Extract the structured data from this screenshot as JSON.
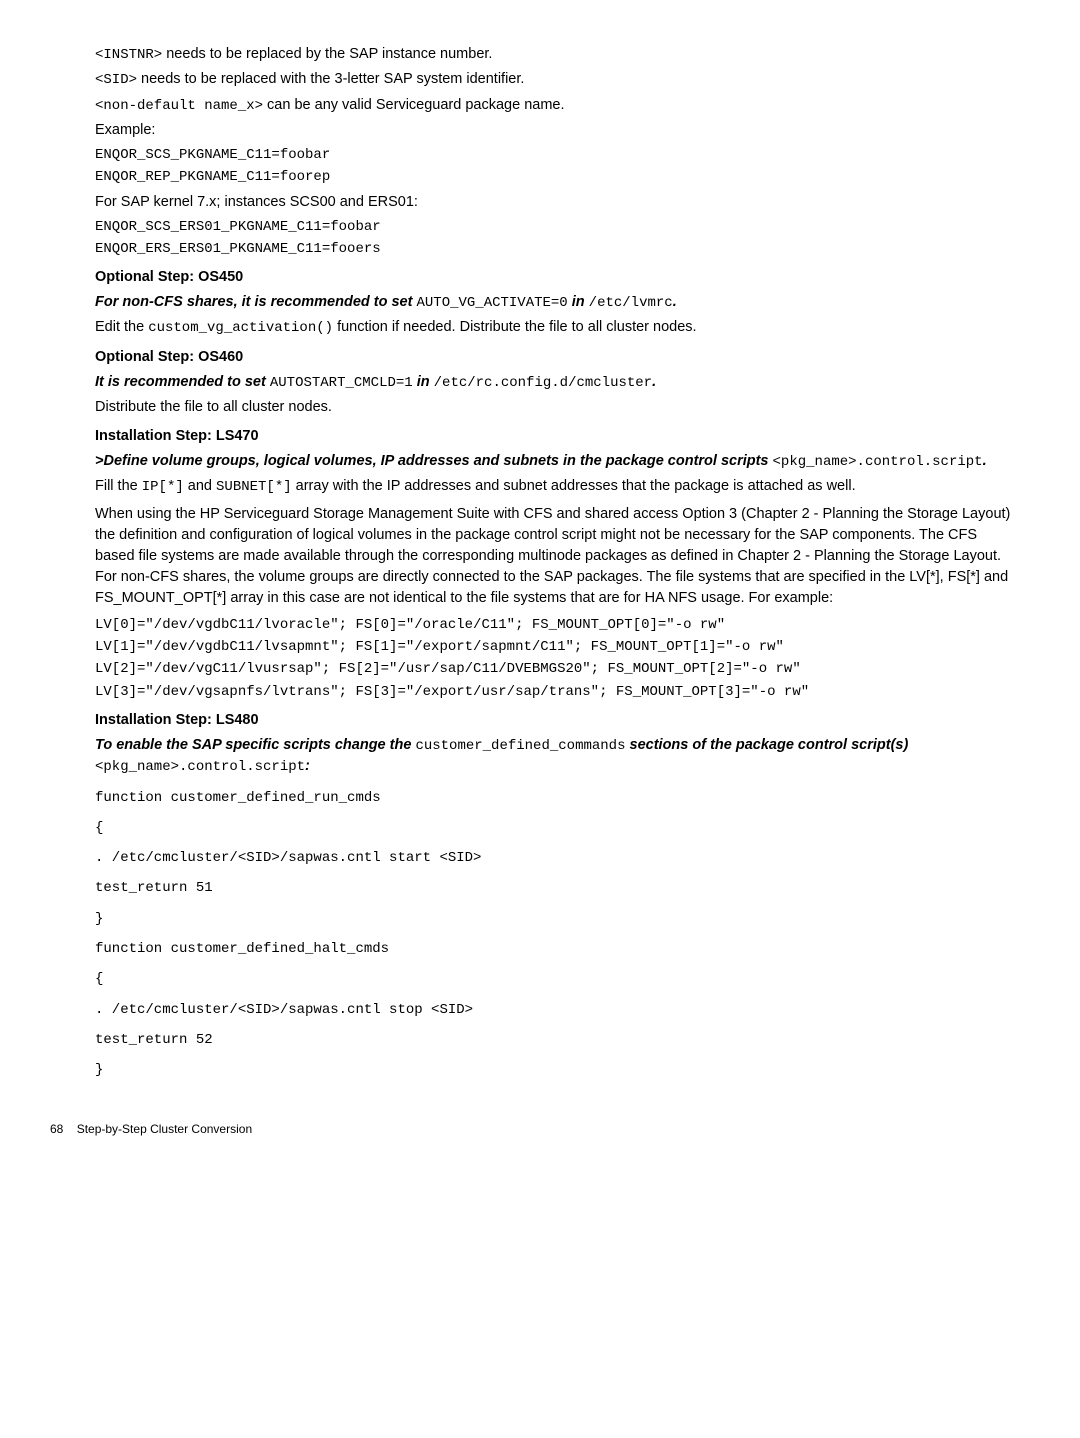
{
  "p1a": "<INSTNR>",
  "p1b": " needs to be replaced by the SAP instance number.",
  "p2a": "<SID>",
  "p2b": " needs to be replaced with the 3-letter SAP system identifier.",
  "p3a": "<non-default name_x>",
  "p3b": " can be any valid Serviceguard package name.",
  "p4": "Example:",
  "p5": "ENQOR_SCS_PKGNAME_C11=foobar",
  "p6": "ENQOR_REP_PKGNAME_C11=foorep",
  "p7": "For SAP kernel 7.x; instances SCS00 and ERS01:",
  "p8": "ENQOR_SCS_ERS01_PKGNAME_C11=foobar",
  "p9": "ENQOR_ERS_ERS01_PKGNAME_C11=fooers",
  "h1": "Optional Step: OS450",
  "p10a": "For non-CFS shares, it is recommended to set ",
  "p10b": "AUTO_VG_ACTIVATE=0",
  "p10c": " in ",
  "p10d": "/etc/lvmrc",
  "p10e": ".",
  "p11a": "Edit the ",
  "p11b": "custom_vg_activation()",
  "p11c": " function if needed. Distribute the file to all cluster nodes.",
  "h2": "Optional Step: OS460",
  "p12a": "It is recommended to set ",
  "p12b": "AUTOSTART_CMCLD=1",
  "p12c": " in ",
  "p12d": "/etc/rc.config.d/cmcluster",
  "p12e": ".",
  "p13": "Distribute the file to all cluster nodes.",
  "h3": "Installation Step: LS470",
  "p14a": ">Define volume groups, logical volumes, IP addresses and subnets in the package control scripts ",
  "p14b": "<pkg_name>.control.script",
  "p14c": ".",
  "p15a": "Fill the ",
  "p15b": "IP[*]",
  "p15c": " and ",
  "p15d": "SUBNET[*]",
  "p15e": " array with the IP addresses and subnet addresses that the package is attached as well.",
  "p16": "When using the HP Serviceguard Storage Management Suite with CFS and shared access Option 3 (Chapter 2 - Planning the Storage Layout) the definition and configuration of logical volumes in the package control script might not be necessary for the SAP components. The CFS based file systems are made available through the corresponding multinode packages as defined in Chapter 2 - Planning the Storage Layout. For non-CFS shares, the volume groups are directly connected to the SAP packages. The file systems that are specified in the LV[*], FS[*] and FS_MOUNT_OPT[*] array in this case are not identical to the file systems that are for HA NFS usage. For example:",
  "p17": "LV[0]=\"/dev/vgdbC11/lvoracle\"; FS[0]=\"/oracle/C11\"; FS_MOUNT_OPT[0]=\"-o rw\"",
  "p18": "LV[1]=\"/dev/vgdbC11/lvsapmnt\"; FS[1]=\"/export/sapmnt/C11\"; FS_MOUNT_OPT[1]=\"-o rw\"",
  "p19": "LV[2]=\"/dev/vgC11/lvusrsap\"; FS[2]=\"/usr/sap/C11/DVEBMGS20\"; FS_MOUNT_OPT[2]=\"-o rw\"",
  "p20": "LV[3]=\"/dev/vgsapnfs/lvtrans\"; FS[3]=\"/export/usr/sap/trans\"; FS_MOUNT_OPT[3]=\"-o rw\"",
  "h4": "Installation Step: LS480",
  "p21a": "To enable the SAP specific scripts change the ",
  "p21b": "customer_defined_commands",
  "p21c": " sections of the package control script(s) ",
  "p21d": "<pkg_name>.control.script",
  "p21e": ":",
  "c1": "function customer_defined_run_cmds",
  "c2": "{",
  "c3": ". /etc/cmcluster/<SID>/sapwas.cntl start <SID>",
  "c4": "test_return 51",
  "c5": "}",
  "c6": "function customer_defined_halt_cmds",
  "c7": "{",
  "c8": ". /etc/cmcluster/<SID>/sapwas.cntl stop <SID>",
  "c9": "test_return 52",
  "c10": "}",
  "footer_page": "68",
  "footer_text": "Step-by-Step Cluster Conversion"
}
